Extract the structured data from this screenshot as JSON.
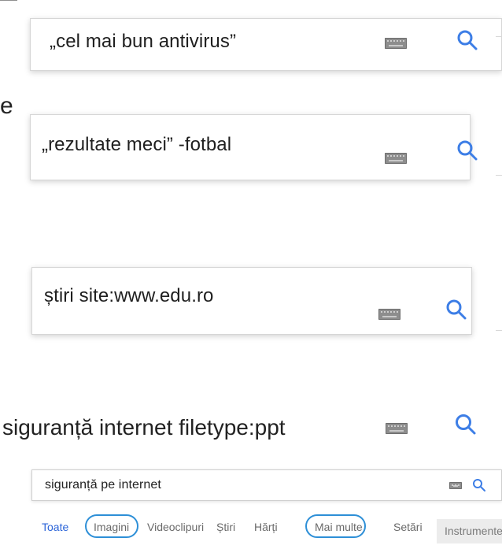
{
  "fragments": {
    "left_letter": "e"
  },
  "examples": [
    {
      "query": "„cel mai bun antivirus”",
      "keyboard_icon": "keyboard-icon",
      "search_icon": "search-icon"
    },
    {
      "query": "„rezultate meci” -fotbal",
      "keyboard_icon": "keyboard-icon",
      "search_icon": "search-icon"
    },
    {
      "query": "știri site:www.edu.ro",
      "keyboard_icon": "keyboard-icon",
      "search_icon": "search-icon"
    },
    {
      "query": "siguranță internet filetype:ppt",
      "keyboard_icon": "keyboard-icon",
      "search_icon": "search-icon"
    }
  ],
  "result_search": {
    "query": "siguranță pe internet",
    "keyboard_icon": "keyboard-icon",
    "search_icon": "search-icon",
    "tabs": [
      "Toate",
      "Imagini",
      "Videoclipuri",
      "Știri",
      "Hărți",
      "Mai multe"
    ],
    "settings_label": "Setări",
    "tools_label": "Instrumente"
  },
  "colors": {
    "accent_blue": "#2b64d8",
    "circle_blue": "#2d8fd7",
    "icon_blue": "#3d7ee6",
    "keyboard_gray": "#8d8d8d",
    "text_dark": "#222222",
    "text_gray": "#6a6a6a",
    "tools_bg": "#ececec"
  }
}
